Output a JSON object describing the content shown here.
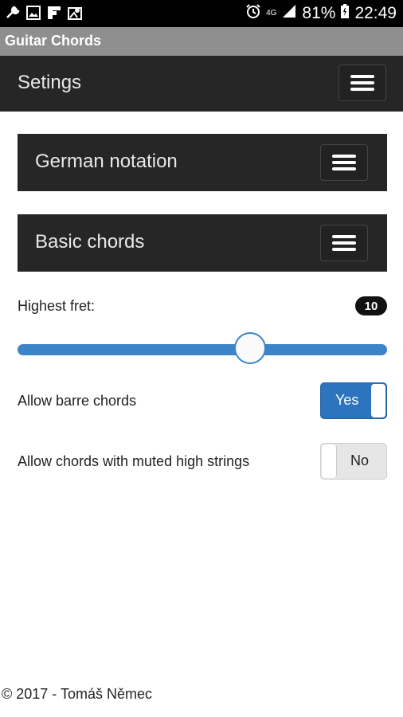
{
  "status_bar": {
    "left_icons": [
      "wrench-icon",
      "image-icon",
      "flipboard-icon",
      "map-icon"
    ],
    "network": "4G",
    "battery": "81%",
    "time": "22:49"
  },
  "app_title": "Guitar Chords",
  "header": {
    "title": "Setings"
  },
  "panels": [
    {
      "title": "German notation"
    },
    {
      "title": "Basic chords"
    }
  ],
  "highest_fret": {
    "label": "Highest fret:",
    "value": "10",
    "slider_fraction": 0.63
  },
  "barre": {
    "label": "Allow barre chords",
    "value": "Yes"
  },
  "muted": {
    "label": "Allow chords with muted high strings",
    "value": "No"
  },
  "footer": "© 2017 - Tomáš Němec",
  "colors": {
    "accent": "#2d74be",
    "bar_dark": "#262626",
    "title_gray": "#8f8f8f"
  }
}
